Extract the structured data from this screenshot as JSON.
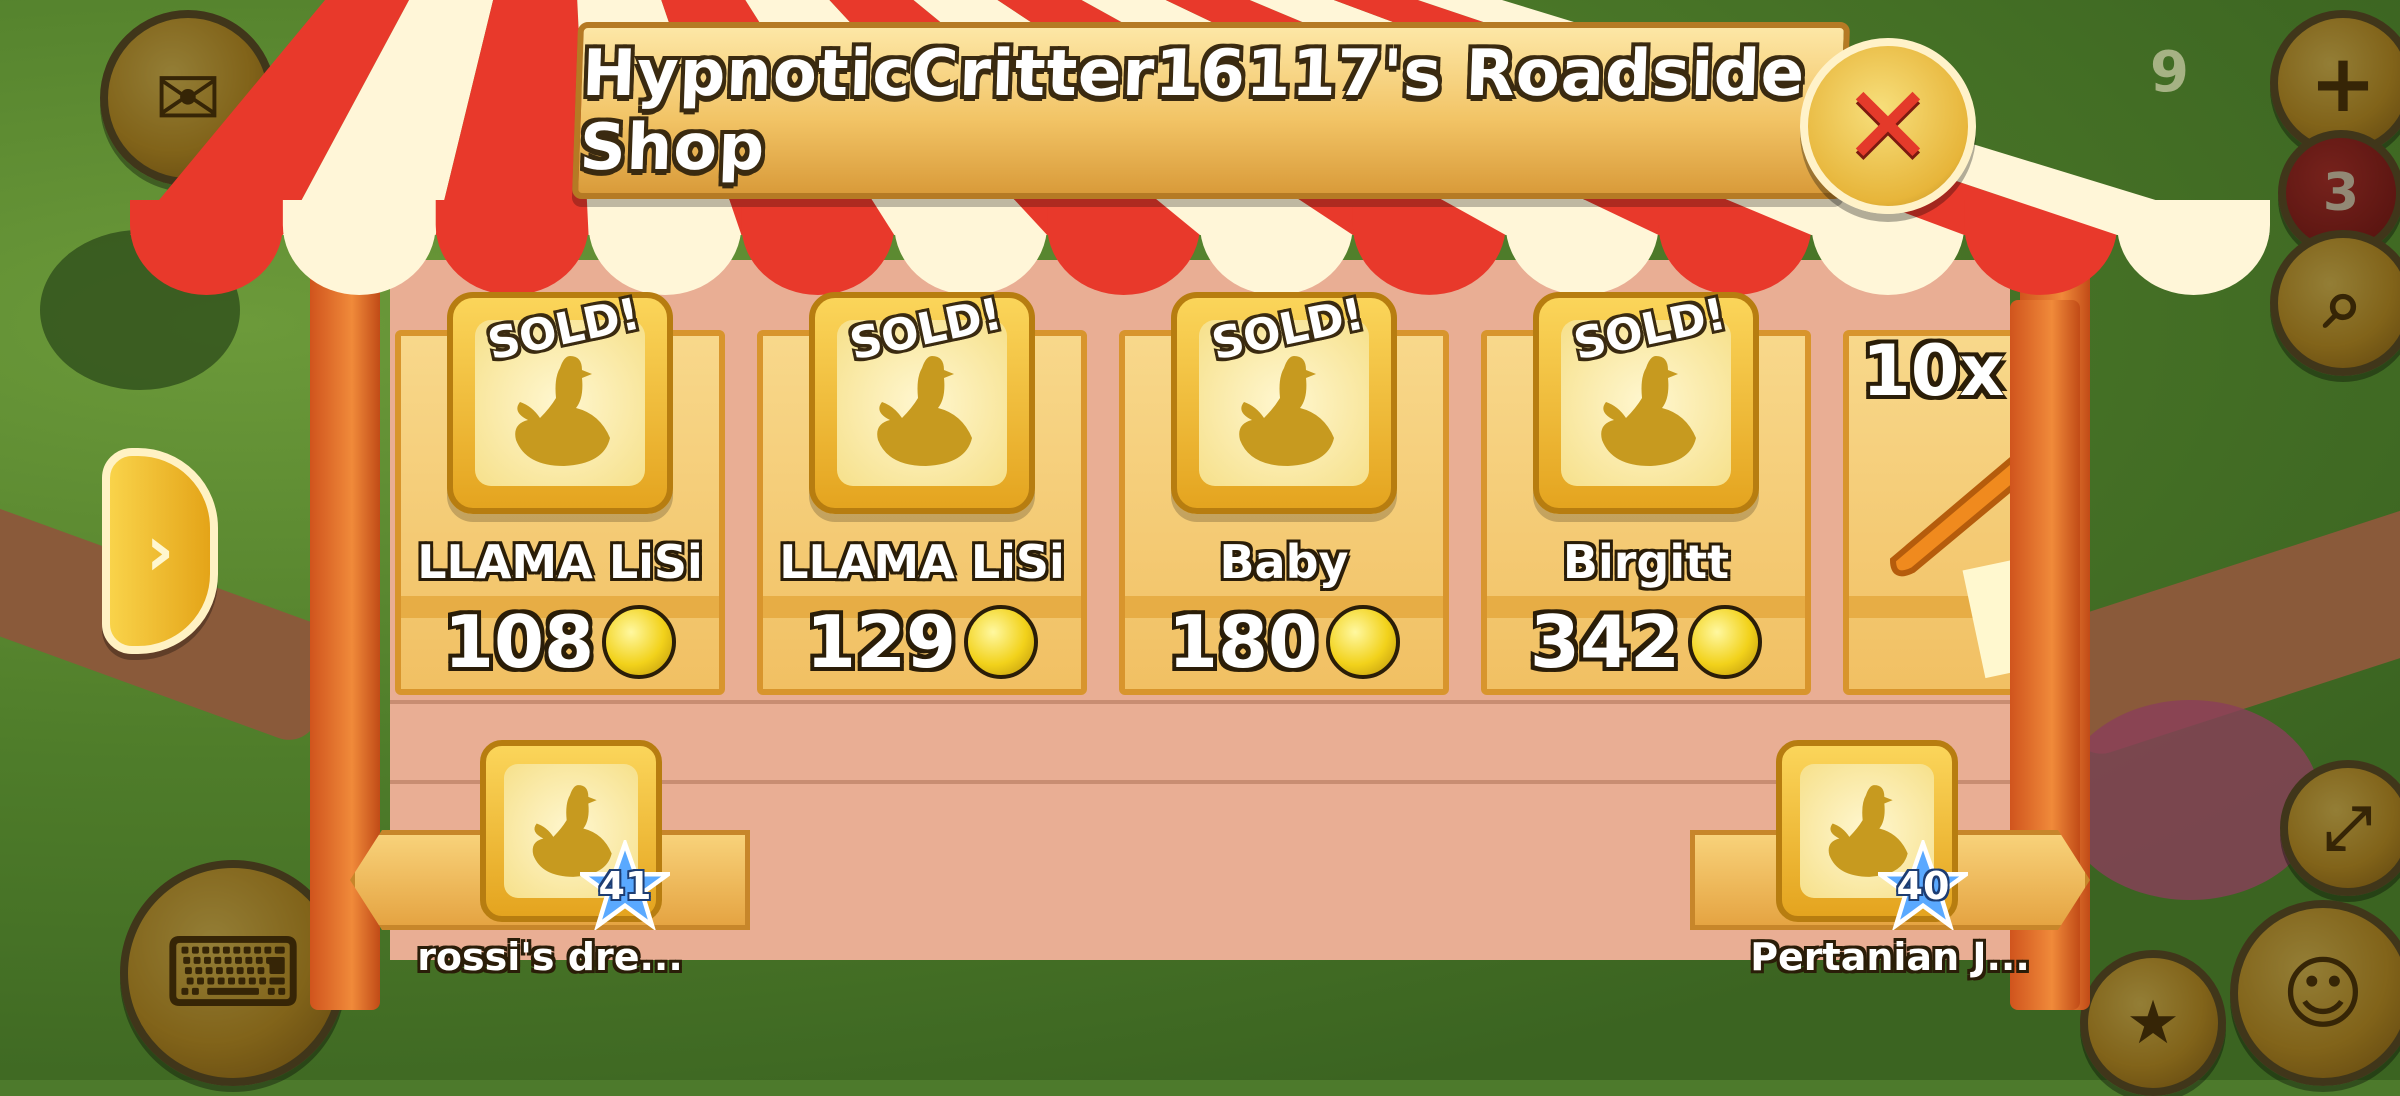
{
  "shop": {
    "title": "HypnoticCritter16117's Roadside Shop",
    "close_icon": "close-icon"
  },
  "crates": [
    {
      "status": "SOLD!",
      "name": "LLAMA LiSi",
      "price": "108",
      "icon": "chicken-silhouette-icon"
    },
    {
      "status": "SOLD!",
      "name": "LLAMA LiSi",
      "price": "129",
      "icon": "chicken-silhouette-icon"
    },
    {
      "status": "SOLD!",
      "name": "Baby",
      "price": "180",
      "icon": "chicken-silhouette-icon"
    },
    {
      "status": "SOLD!",
      "name": "Birgitt",
      "price": "342",
      "icon": "chicken-silhouette-icon"
    }
  ],
  "partial_crate": {
    "quantity": "10x",
    "item_icon": "carrot-icon"
  },
  "neighbors": {
    "previous": {
      "name": "rossi's dre...",
      "level": "41"
    },
    "next": {
      "name": "Pertanian J...",
      "level": "40"
    }
  },
  "hud": {
    "top_right_count": "3",
    "coin_partial": "9",
    "icons": [
      "mail-icon",
      "plus-icon",
      "search-icon",
      "cash-register-icon",
      "expand-icon",
      "friends-icon"
    ]
  },
  "colors": {
    "awning_red": "#e8392b",
    "awning_cream": "#fff6d8",
    "crate_wood": "#f1c063",
    "title_text": "#ffffff",
    "coin": "#f2d21b"
  }
}
